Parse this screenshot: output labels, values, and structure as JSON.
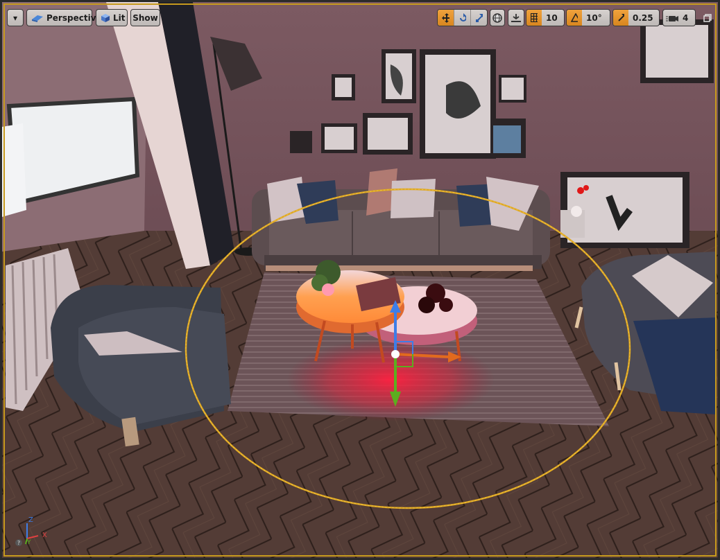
{
  "toolbar_left": {
    "menu_caret": "▾",
    "perspective_label": "Perspective",
    "lit_label": "Lit",
    "show_label": "Show"
  },
  "toolbar_right": {
    "grid_snap_value": "10",
    "rotation_snap_value": "10°",
    "scale_snap_value": "0.25",
    "camera_speed_value": "4"
  },
  "axis_labels": {
    "z": "Z",
    "y": "Y",
    "x": "X"
  },
  "colors": {
    "accent_orange": "#e09830",
    "selection_yellow": "#d8a821",
    "gizmo_x": "#e26a1e",
    "gizmo_y": "#5cae1f",
    "gizmo_z": "#3d7ee8"
  }
}
